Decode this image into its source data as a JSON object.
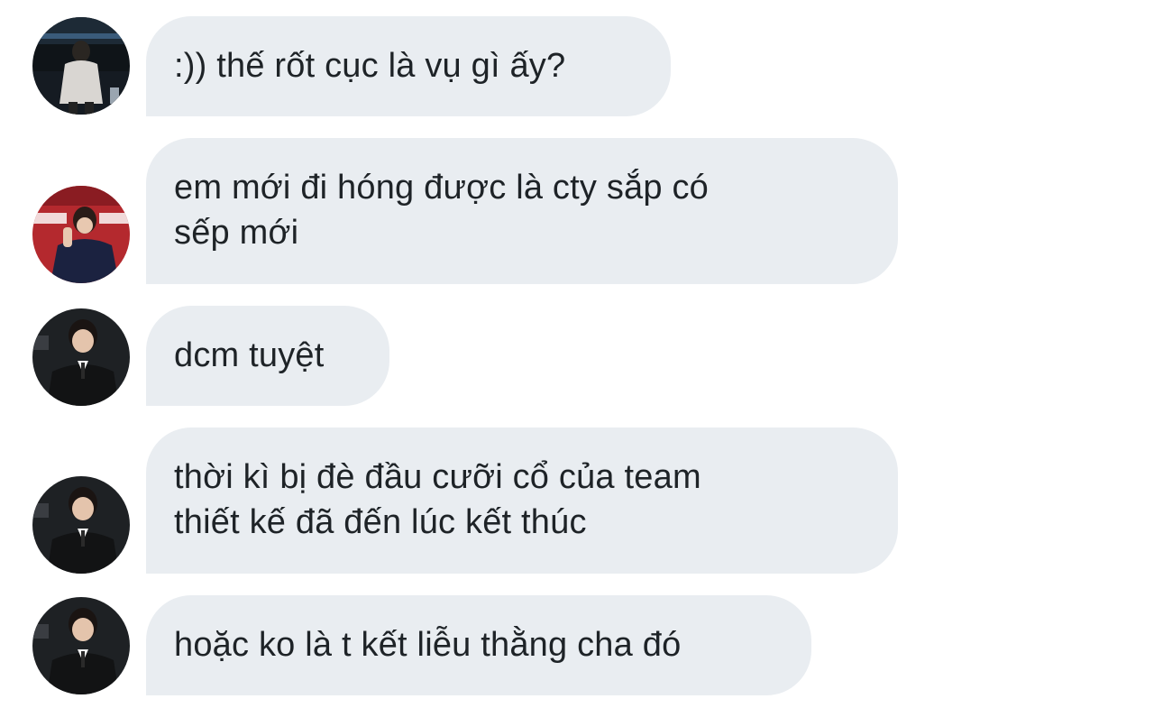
{
  "conversation": {
    "messages": [
      {
        "sender": "user-a",
        "text": ":)) thế rốt cục là vụ gì ấy?"
      },
      {
        "sender": "user-b",
        "text": "em mới đi hóng được là cty sắp có\nsếp mới"
      },
      {
        "sender": "user-c",
        "text": "dcm tuyệt"
      },
      {
        "sender": "user-c",
        "text": "thời kì bị đè đầu cưỡi cổ của team\nthiết kế đã đến lúc kết thúc"
      },
      {
        "sender": "user-c",
        "text": "hoặc ko là t kết liễu thằng cha đó"
      }
    ]
  },
  "colors": {
    "bubble_background": "#e9edf1",
    "text": "#1e2327",
    "page_background": "#ffffff"
  }
}
